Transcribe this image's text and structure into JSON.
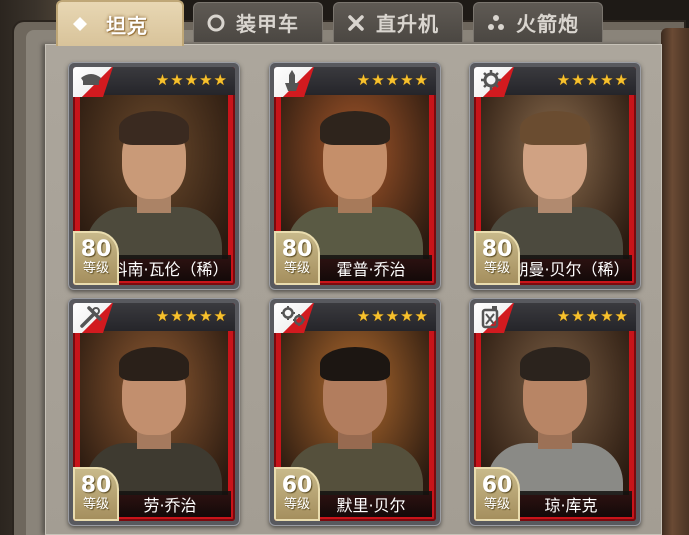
{
  "tabs": [
    {
      "label": "坦克",
      "icon": "diamond-icon",
      "active": true
    },
    {
      "label": "装甲车",
      "icon": "circle-icon",
      "active": false
    },
    {
      "label": "直升机",
      "icon": "crossed-x-icon",
      "active": false
    },
    {
      "label": "火箭炮",
      "icon": "triple-dot-icon",
      "active": false
    }
  ],
  "cards": [
    {
      "name": "科南·瓦伦（稀）",
      "level": "80",
      "level_label": "等级",
      "stars": 5,
      "class_icon": "officer-cap-icon",
      "bg": "#6b4a2c",
      "skin": "#c99a78",
      "hair": "#3a2a20",
      "uniform": "#4d4a3c"
    },
    {
      "name": "霍普·乔治",
      "level": "80",
      "level_label": "等级",
      "stars": 5,
      "class_icon": "hand-missile-icon",
      "bg": "#a5572a",
      "skin": "#c58f6a",
      "hair": "#2e241c",
      "uniform": "#5a5a44"
    },
    {
      "name": "朗曼·贝尔（稀）",
      "level": "80",
      "level_label": "等级",
      "stars": 5,
      "class_icon": "gear-icon",
      "bg": "#8a6c4e",
      "skin": "#d0a283",
      "hair": "#6a4c30",
      "uniform": "#4c4a3e"
    },
    {
      "name": "劳·乔治",
      "level": "80",
      "level_label": "等级",
      "stars": 5,
      "class_icon": "wrench-screwdriver-icon",
      "bg": "#8e5a32",
      "skin": "#c28f6e",
      "hair": "#2a2019",
      "uniform": "#3e3a30"
    },
    {
      "name": "默里·贝尔",
      "level": "60",
      "level_label": "等级",
      "stars": 5,
      "class_icon": "gears-icon",
      "bg": "#b06a2e",
      "skin": "#b27d5e",
      "hair": "#1c1612",
      "uniform": "#55503c"
    },
    {
      "name": "琼·库克",
      "level": "60",
      "level_label": "等级",
      "stars": 5,
      "class_icon": "fuel-can-icon",
      "bg": "#7a5e44",
      "skin": "#b88565",
      "hair": "#2b231d",
      "uniform": "#8a8a86"
    }
  ]
}
